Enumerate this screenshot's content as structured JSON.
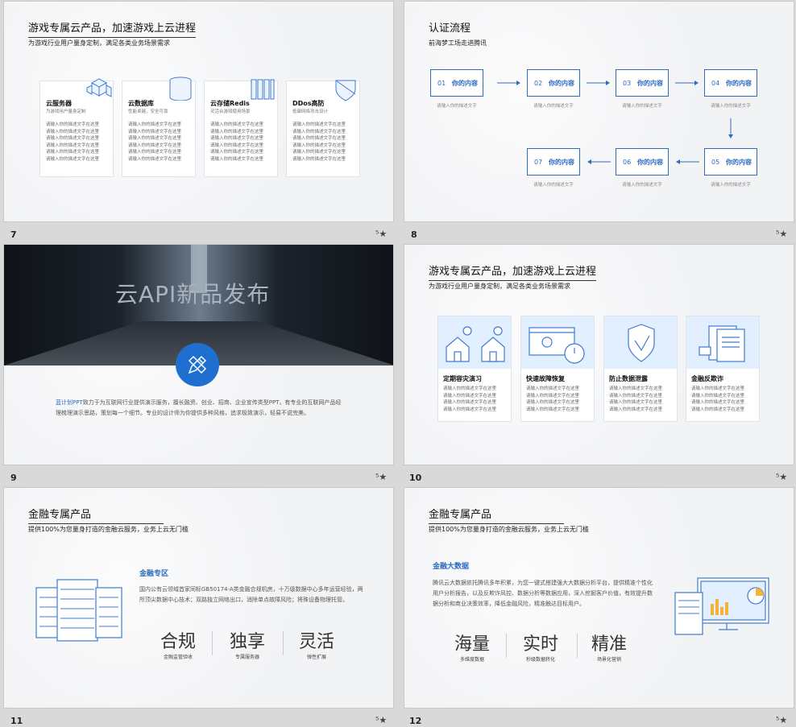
{
  "slides": {
    "s7": {
      "num": "7",
      "title": "游戏专属云产品，加速游戏上云进程",
      "subtitle": "为游戏行业用户量身定制，满足各类业务场景需求",
      "cards": [
        {
          "title": "云服务器",
          "sub": "为游戏用户量身定制",
          "icon": "cube-cluster-icon"
        },
        {
          "title": "云数据库",
          "sub": "性能卓越，安全可靠",
          "icon": "database-icon"
        },
        {
          "title": "云存储Redis",
          "sub": "灵活合游戏使用场景",
          "icon": "storage-bars-icon"
        },
        {
          "title": "DDos高防",
          "sub": "抵御网络攻击设计",
          "icon": "shield-icon"
        }
      ],
      "card_body": "请输入你的描述文字在这里\n请输入你的描述文字在这里\n请输入你的描述文字在这里\n请输入你的描述文字在这里\n请输入你的描述文字在这里\n请输入你的描述文字在这里"
    },
    "s8": {
      "num": "8",
      "title": "认证流程",
      "subtitle": "前海梦工场走进腾讯",
      "steps": [
        {
          "n": "01",
          "label": "你的内容",
          "desc": "请输入你的描述文字"
        },
        {
          "n": "02",
          "label": "你的内容",
          "desc": "请输入你的描述文字"
        },
        {
          "n": "03",
          "label": "你的内容",
          "desc": "请输入你的描述文字"
        },
        {
          "n": "04",
          "label": "你的内容",
          "desc": "请输入你的描述文字"
        },
        {
          "n": "05",
          "label": "你的内容",
          "desc": "请输入你的描述文字"
        },
        {
          "n": "06",
          "label": "你的内容",
          "desc": "请输入你的描述文字"
        },
        {
          "n": "07",
          "label": "你的内容",
          "desc": "请输入你的描述文字"
        }
      ]
    },
    "s9": {
      "num": "9",
      "banner_title": "云API新品发布",
      "brand": "蓝计划PPT",
      "body": "致力于为互联网行业提供演示服务，擅长融资、创业、招商、企业宣传类型PPT，有专业的互联网产品经理梳理演示思路，策划每一个细节。专业的设计师为你提供多种风格，追求极致演示，轻易不说完美。"
    },
    "s10": {
      "num": "10",
      "title": "游戏专属云产品，加速游戏上云进程",
      "subtitle": "为游戏行业用户量身定制，满足各类业务场景需求",
      "cards": [
        {
          "title": "定期容灾演习",
          "icon": "houses-icon"
        },
        {
          "title": "快速故障恢复",
          "icon": "stopwatch-screen-icon"
        },
        {
          "title": "防止数据泄露",
          "icon": "shield-check-icon"
        },
        {
          "title": "金融反欺诈",
          "icon": "documents-icon"
        }
      ],
      "card_body": "请输入你的描述文字在这里\n请输入你的描述文字在这里\n请输入你的描述文字在这里\n请输入你的描述文字在这里"
    },
    "s11": {
      "num": "11",
      "title": "金融专属产品",
      "subtitle": "提供100%为您量身打造的金融云服务，业务上云无门槛",
      "section": "金融专区",
      "body": "国内公有云领域首家同标GB50174-A类金融合规机房，十万级数据中心多年运营经验，两所顶尖数据中心技术；双路独立网络出口，消除单点故障风险；将殊设备物理托管。",
      "features": [
        {
          "big": "合规",
          "sub": "金融监管验收"
        },
        {
          "big": "独享",
          "sub": "专属服务器"
        },
        {
          "big": "灵活",
          "sub": "弹性扩展"
        }
      ]
    },
    "s12": {
      "num": "12",
      "title": "金融专属产品",
      "subtitle": "提供100%为您量身打造的金融云服务，业务上云无门槛",
      "section": "金融大数据",
      "body": "腾讯云大数据依托腾讯多年积累，为您一键式搭建强大大数据分析平台，提供精准个性化用户分析报告，以及反欺诈风控、数据分析等数据应用，深入挖掘客户价值，有效提升数据分析和商业决策效率，降低金融风险，精准触达目标用户。",
      "features": [
        {
          "big": "海量",
          "sub": "多维度数据"
        },
        {
          "big": "实时",
          "sub": "秒级数据转化"
        },
        {
          "big": "精准",
          "sub": "场景化营销"
        }
      ]
    }
  },
  "colors": {
    "accent": "#2d6cc0",
    "light_blue": "#e2efff"
  }
}
